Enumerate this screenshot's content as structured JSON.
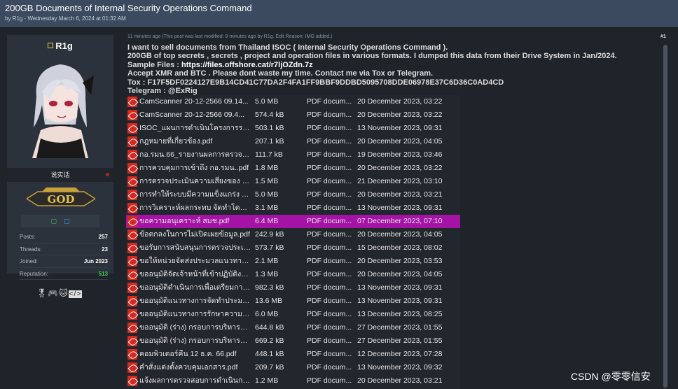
{
  "header": {
    "title": "200GB Documents of Internal Security Operations Command",
    "meta": "by R1g - Wednesday March 6, 2024 at 01:32 AM"
  },
  "user": {
    "username": "R1g",
    "user_title": "说实话",
    "rank": "GOD",
    "stats": [
      {
        "label": "Posts:",
        "value": "257"
      },
      {
        "label": "Threads:",
        "value": "23"
      },
      {
        "label": "Joined:",
        "value": "Jun 2023"
      },
      {
        "label": "Reputation:",
        "value": "513"
      }
    ],
    "award_icons": [
      "medal-icon",
      "gamepad-icon",
      "cat-icon",
      "code-icon"
    ]
  },
  "post": {
    "meta": "11 minutes ago  (This post was last modified: 9 minutes ago by R1g. Edit Reason: IMG added.)",
    "number": "#1",
    "lines": [
      "I want to sell documents from Thailand ISOC ( Internal Security Operations Command ).",
      "200GB of top secrets , secrets , project and operation files in various formats. I dumped this data from their Drive System in Jan/2024.",
      "Sample Files : ",
      "Accept XMR and BTC . Please dont waste my time. Contact me via Tox or Telegram.",
      "Tox : F17F5DF0224127E9B14CD41C77DA2F4FA1FF9BBF9DDBD5095708DDE06978E37C6D36C0AD4CD",
      "Telegram : @ExRig"
    ],
    "sample_link": "https://files.offshore.cat/r7ljOZdn.7z"
  },
  "files": [
    {
      "name": "CamScanner 20-12-2566 09.14...",
      "size": "5.0 MB",
      "type": "PDF docum...",
      "date": "20 December 2023, 03:22"
    },
    {
      "name": "CamScanner 20-12-2566 09.4...",
      "size": "574.4 kB",
      "type": "PDF docum...",
      "date": "20 December 2023, 03:22"
    },
    {
      "name": "ISOC_แผนการดำเนินโครงการระยะ...",
      "size": "503.1 kB",
      "type": "PDF docum...",
      "date": "13 November 2023, 09:31"
    },
    {
      "name": "กฎหมายที่เกี่ยวข้อง.pdf",
      "size": "207.1 kB",
      "type": "PDF docum...",
      "date": "20 December 2023, 04:05"
    },
    {
      "name": "กอ.รมน.66_รายงานผลการตรวจส...",
      "size": "111.7 kB",
      "type": "PDF docum...",
      "date": "19 December 2023, 03:46"
    },
    {
      "name": "การควบคุมการเข้าถึง กอ.รมน..pdf",
      "size": "1.8 MB",
      "type": "PDF docum...",
      "date": "20 December 2023, 03:22"
    },
    {
      "name": "การตรวจประเมินความเสี่ยงของ ศต...",
      "size": "1.5 MB",
      "type": "PDF docum...",
      "date": "21 December 2023, 03:10"
    },
    {
      "name": "การทำให้ระบบมีความแข็งแกร่ง กอ....",
      "size": "5.0 MB",
      "type": "PDF docum...",
      "date": "20 December 2023, 03:21"
    },
    {
      "name": "การวิเคราะห์ผลกระทบ จัดทำโดย ส่ว...",
      "size": "3.1 MB",
      "type": "PDF docum...",
      "date": "13 November 2023, 09:31"
    },
    {
      "name": "ขอความอนุเคราะห์ สมช.pdf",
      "size": "6.4 MB",
      "type": "PDF docum...",
      "date": "07 December 2023, 07:10",
      "selected": true
    },
    {
      "name": "ข้อตกลงในการไม่เปิดเผยข้อมูล.pdf",
      "size": "242.9 kB",
      "type": "PDF docum...",
      "date": "20 December 2023, 04:05"
    },
    {
      "name": "ขอรับการสนับสนุนการตรวจประเมิน...",
      "size": "573.7 kB",
      "type": "PDF docum...",
      "date": "15 December 2023, 08:02"
    },
    {
      "name": "ขอให้หน่วยจัดส่งประมวลแนวทางป...",
      "size": "2.1 MB",
      "type": "PDF docum...",
      "date": "20 December 2023, 03:53"
    },
    {
      "name": "ขออนุมัติจัดเจ้าหน้าที่เข้าปฏิบัติงาน...",
      "size": "1.3 MB",
      "type": "PDF docum...",
      "date": "20 December 2023, 04:05"
    },
    {
      "name": "ขออนุมัติดำเนินการเพื่อเตรียมการรั...",
      "size": "982.3 kB",
      "type": "PDF docum...",
      "date": "13 November 2023, 09:31"
    },
    {
      "name": "ขออนุมัติแนวทางการจัดทำประมวล ...",
      "size": "13.6 MB",
      "type": "PDF docum...",
      "date": "13 November 2023, 09:31"
    },
    {
      "name": "ขออนุมัติแนวทางการรักษาความมั่น...",
      "size": "6.0 MB",
      "type": "PDF docum...",
      "date": "13 December 2023, 08:25"
    },
    {
      "name": "ขออนุมัติ (ร่าง) กรอบการบริหารจัด...",
      "size": "644.8 kB",
      "type": "PDF docum...",
      "date": "27 December 2023, 01:55"
    },
    {
      "name": "ขออนุมัติ (ร่าง) กรอบการบริหารจัด...",
      "size": "669.2 kB",
      "type": "PDF docum...",
      "date": "27 December 2023, 01:55"
    },
    {
      "name": "คอมพิวเตอร์คืน 12 ธ.ค. 66.pdf",
      "size": "448.1 kB",
      "type": "PDF docum...",
      "date": "12 December 2023, 07:28"
    },
    {
      "name": "คำสั่งแต่งตั้งควบคุมเอกสาร.pdf",
      "size": "209.7 kB",
      "type": "PDF docum...",
      "date": "13 November 2023, 09:32"
    },
    {
      "name": "แจ้งผลการตรวจสอบการดำเนินการ...",
      "size": "1.2 MB",
      "type": "PDF docum...",
      "date": "20 December 2023, 03:21"
    }
  ],
  "watermark": "CSDN @零零信安"
}
